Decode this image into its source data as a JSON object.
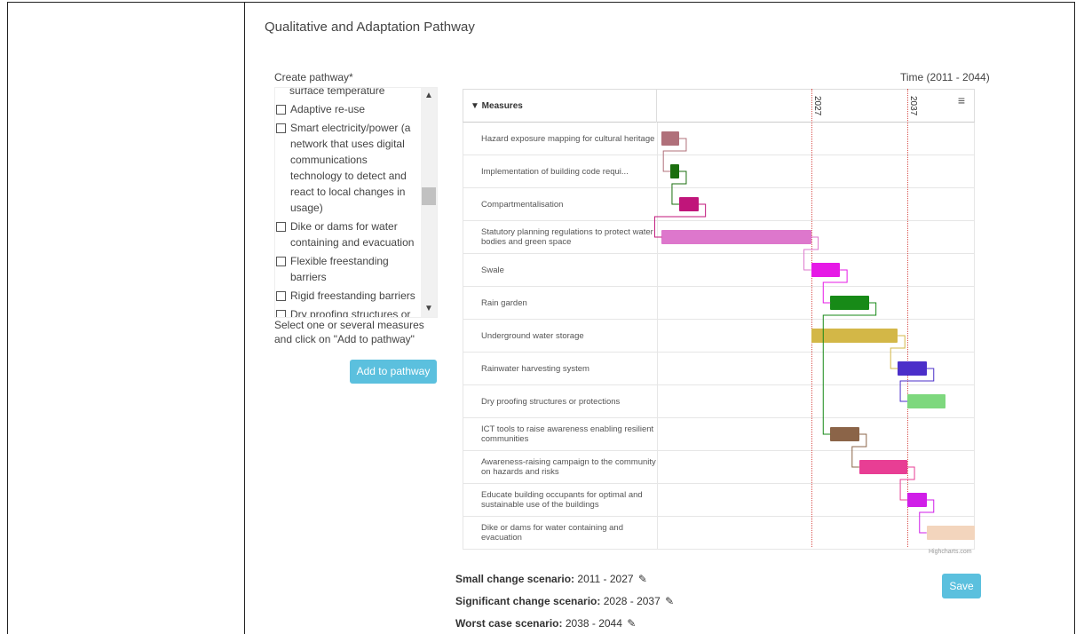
{
  "section_title": "Qualitative and Adaptation Pathway",
  "create_label": "Create pathway*",
  "time_label": "Time (2011 - 2044)",
  "measure_list": {
    "top_partial": "surface temperature",
    "items": [
      "Adaptive re-use",
      "Smart electricity/power (a network that uses digital communications technology to detect and react to local changes in usage)",
      "Dike or dams for water containing and evacuation",
      "Flexible freestanding barriers",
      "Rigid freestanding barriers",
      "Dry proofing structures or"
    ],
    "scroll_up_icon": "chevron-up-icon",
    "scroll_down_icon": "chevron-down-icon"
  },
  "help_text": "Select one or several measures and click on \"Add to pathway\"",
  "add_button": "Add to pathway",
  "chart": {
    "header": "▼ Measures",
    "menu_icon": "hamburger-menu-icon",
    "plotlines": [
      "2027",
      "2037"
    ],
    "credit": "Highcharts.com"
  },
  "chart_data": {
    "type": "gantt",
    "x_range": [
      2011,
      2044
    ],
    "plot_lines": [
      2027,
      2037
    ],
    "tasks": [
      {
        "name": "Hazard exposure mapping for cultural heritage",
        "start": 2011.5,
        "end": 2013.3,
        "color": "#b0707a"
      },
      {
        "name": "Implementation of building code requi...",
        "start": 2012.4,
        "end": 2013.3,
        "color": "#1a6e0e"
      },
      {
        "name": "Compartmentalisation",
        "start": 2013.3,
        "end": 2015.3,
        "color": "#c0157a"
      },
      {
        "name": "Statutory planning regulations to protect water bodies and green space",
        "start": 2011.5,
        "end": 2027,
        "color": "#dd77cc"
      },
      {
        "name": "Swale",
        "start": 2027,
        "end": 2030,
        "color": "#e619e6"
      },
      {
        "name": "Rain garden",
        "start": 2029,
        "end": 2033,
        "color": "#178a17"
      },
      {
        "name": "Underground water storage",
        "start": 2027,
        "end": 2036,
        "color": "#d3b747"
      },
      {
        "name": "Rainwater harvesting system",
        "start": 2036,
        "end": 2039,
        "color": "#4b2fc9"
      },
      {
        "name": "Dry proofing structures or protections",
        "start": 2037,
        "end": 2041,
        "color": "#7ed87e"
      },
      {
        "name": "ICT tools to raise awareness enabling resilient communities",
        "start": 2029,
        "end": 2032,
        "color": "#8b6448"
      },
      {
        "name": "Awareness-raising campaign to the community on hazards and risks",
        "start": 2032,
        "end": 2037,
        "color": "#e83e94"
      },
      {
        "name": "Educate building occupants for optimal and sustainable use of the buildings",
        "start": 2037,
        "end": 2039,
        "color": "#d01ee8"
      },
      {
        "name": "Dike or dams for water containing and evacuation",
        "start": 2039,
        "end": 2044,
        "color": "#f3d5bd"
      }
    ]
  },
  "scenarios": [
    {
      "label": "Small change scenario:",
      "range": "2011 - 2027"
    },
    {
      "label": "Significant change scenario:",
      "range": "2028 - 2037"
    },
    {
      "label": "Worst case scenario:",
      "range": "2038 - 2044"
    }
  ],
  "save_button": "Save"
}
